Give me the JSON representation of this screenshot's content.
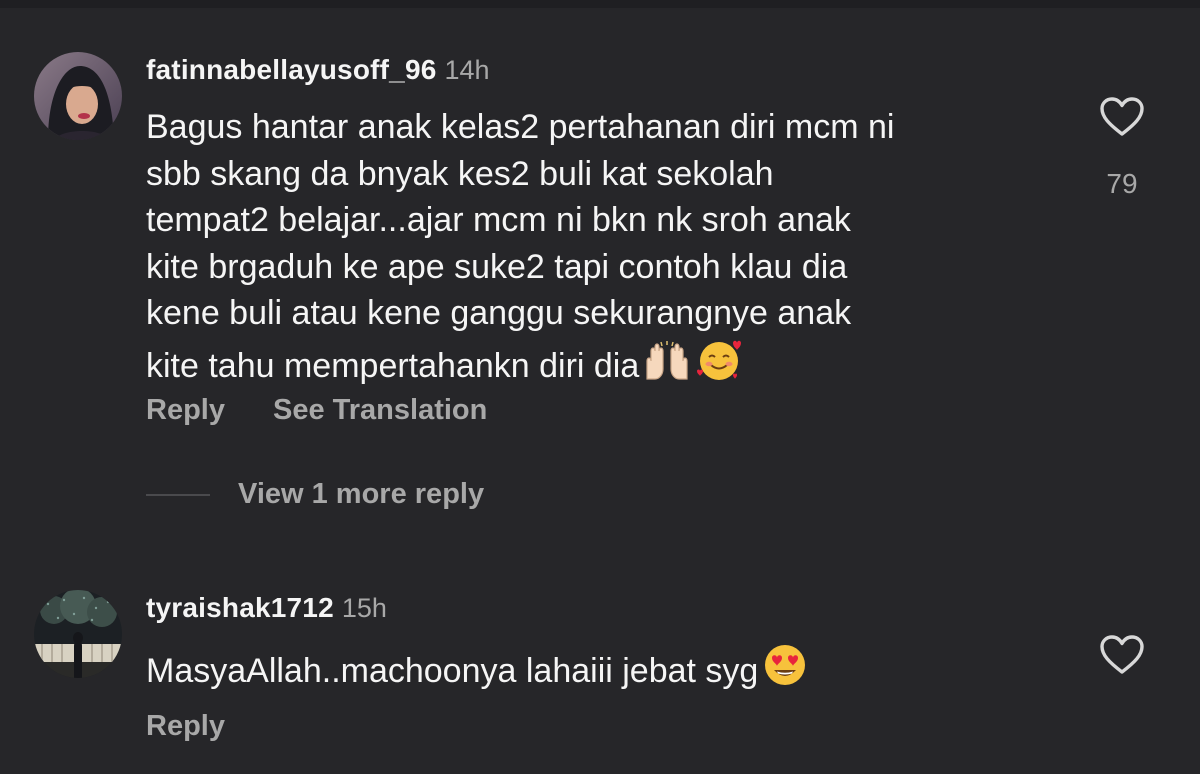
{
  "comments": [
    {
      "username": "fatinnabellayusoff_96",
      "timestamp": "14h",
      "text": "Bagus hantar anak kelas2 pertahanan diri mcm ni\nsbb skang da bnyak kes2 buli kat sekolah\ntempat2 belajar...ajar mcm ni bkn nk sroh anak\nkite brgaduh ke ape suke2 tapi contoh klau dia\nkene buli atau kene ganggu sekurangnye anak\nkite tahu mempertahankn diri dia",
      "emojis": [
        "raising-hands-emoji",
        "smiling-face-with-hearts-emoji"
      ],
      "like_count": "79",
      "actions": {
        "reply": "Reply",
        "translate": "See Translation"
      },
      "view_replies": "View 1 more reply"
    },
    {
      "username": "tyraishak1712",
      "timestamp": "15h",
      "text": "MasyaAllah..machoonya lahaiii jebat syg",
      "emojis": [
        "heart-eyes-emoji"
      ],
      "like_count": "",
      "actions": {
        "reply": "Reply"
      }
    }
  ],
  "colors": {
    "background": "#262629",
    "primary_text": "#f5f5f5",
    "secondary_text": "#a8a8a8"
  }
}
